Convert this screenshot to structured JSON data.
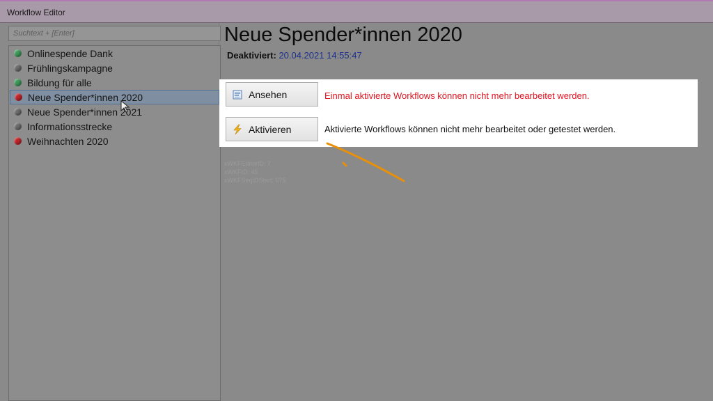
{
  "window": {
    "title": "Workflow Editor"
  },
  "search": {
    "placeholder": "Suchtext + [Enter]"
  },
  "tree": {
    "items": [
      {
        "label": "Onlinespende Dank",
        "status": "green",
        "color": "#3f9a5a"
      },
      {
        "label": "Frühlingskampagne",
        "status": "gray",
        "color": "#6e6e6e"
      },
      {
        "label": "Bildung für alle",
        "status": "green",
        "color": "#3f9a5a"
      },
      {
        "label": "Neue Spender*innen 2020",
        "status": "red",
        "color": "#c0262b",
        "selected": true
      },
      {
        "label": "Neue Spender*innen 2021",
        "status": "gray",
        "color": "#6e6e6e"
      },
      {
        "label": "Informationsstrecke",
        "status": "gray",
        "color": "#6e6e6e"
      },
      {
        "label": "Weihnachten 2020",
        "status": "red",
        "color": "#c0262b"
      }
    ]
  },
  "detail": {
    "title": "Neue Spender*innen 2020",
    "status_label": "Deaktiviert:",
    "status_value": "20.04.2021 14:55:47"
  },
  "actions": {
    "view_label": "Ansehen",
    "view_message": "Einmal aktivierte Workflows können nicht mehr bearbeitet werden.",
    "activate_label": "Aktivieren",
    "activate_message": "Aktivierte Workflows können nicht mehr bearbeitet oder getestet werden."
  },
  "debug": {
    "line1": "xWKFEditorID: 7",
    "line2": "xWKFID: 45",
    "line3": "xWKFSeqIDStart: 675"
  },
  "colors": {
    "accent_red": "#e0141e",
    "status_blue": "#1d2f8c",
    "annotation": "#e8900a"
  }
}
